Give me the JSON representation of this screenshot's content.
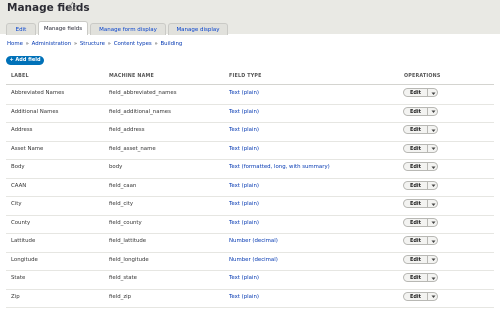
{
  "page": {
    "title": "Manage fields"
  },
  "tabs": [
    {
      "label": "Edit",
      "active": false
    },
    {
      "label": "Manage fields",
      "active": true
    },
    {
      "label": "Manage form display",
      "active": false
    },
    {
      "label": "Manage display",
      "active": false
    }
  ],
  "breadcrumb": [
    "Home",
    "Administration",
    "Structure",
    "Content types",
    "Building"
  ],
  "breadcrumb_separator": "»",
  "add_field_label": "+ Add field",
  "table": {
    "headers": {
      "label": "LABEL",
      "machine_name": "MACHINE NAME",
      "field_type": "FIELD TYPE",
      "operations": "OPERATIONS"
    },
    "rows": [
      {
        "label": "Abbreviated Names",
        "machine_name": "field_abbreviated_names",
        "field_type": "Text (plain)",
        "edit": "Edit"
      },
      {
        "label": "Additional Names",
        "machine_name": "field_additional_names",
        "field_type": "Text (plain)",
        "edit": "Edit"
      },
      {
        "label": "Address",
        "machine_name": "field_address",
        "field_type": "Text (plain)",
        "edit": "Edit"
      },
      {
        "label": "Asset Name",
        "machine_name": "field_asset_name",
        "field_type": "Text (plain)",
        "edit": "Edit"
      },
      {
        "label": "Body",
        "machine_name": "body",
        "field_type": "Text (formatted, long, with summary)",
        "edit": "Edit"
      },
      {
        "label": "CAAN",
        "machine_name": "field_caan",
        "field_type": "Text (plain)",
        "edit": "Edit"
      },
      {
        "label": "City",
        "machine_name": "field_city",
        "field_type": "Text (plain)",
        "edit": "Edit"
      },
      {
        "label": "County",
        "machine_name": "field_county",
        "field_type": "Text (plain)",
        "edit": "Edit"
      },
      {
        "label": "Lattitude",
        "machine_name": "field_lattitude",
        "field_type": "Number (decimal)",
        "edit": "Edit"
      },
      {
        "label": "Longitude",
        "machine_name": "field_longitude",
        "field_type": "Number (decimal)",
        "edit": "Edit"
      },
      {
        "label": "State",
        "machine_name": "field_state",
        "field_type": "Text (plain)",
        "edit": "Edit"
      },
      {
        "label": "Zip",
        "machine_name": "field_zip",
        "field_type": "Text (plain)",
        "edit": "Edit"
      }
    ]
  },
  "icons": {
    "shortcut": "star-icon",
    "operations_dropdown": "chevron-down-icon"
  },
  "colors": {
    "link": "#0036b1",
    "primary_button": "#0071b8",
    "header_bg": "#e9e9e4"
  }
}
